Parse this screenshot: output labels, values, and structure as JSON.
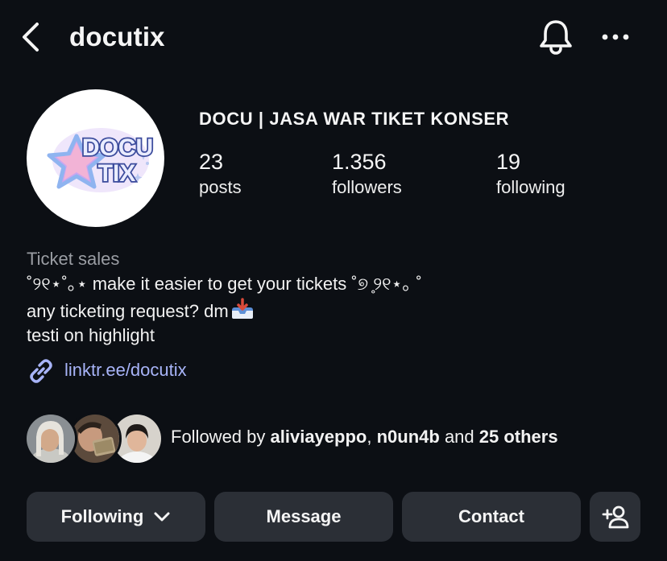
{
  "header": {
    "username": "docutix",
    "icons": {
      "back": "chevron-left-icon",
      "notifications": "bell-icon",
      "more": "more-horizontal-icon"
    }
  },
  "profile": {
    "avatar_text_line1": "DOCU",
    "avatar_text_line2": "TIX",
    "display_name": "DOCU | JASA WAR TIKET KONSER",
    "stats": [
      {
        "value": "23",
        "label": "posts"
      },
      {
        "value": "1.356",
        "label": "followers"
      },
      {
        "value": "19",
        "label": "following"
      }
    ]
  },
  "bio": {
    "category": "Ticket sales",
    "line1": "˚୨୧⋆˚｡⋆ make it easier to get your tickets ˚୭ ̥୨୧⋆｡ ˚",
    "line2": "any ticketing request? dm",
    "line3": "testi on highlight",
    "link": "linktr.ee/docutix"
  },
  "followed_by": {
    "prefix": "Followed by ",
    "user1": "aliviayeppo",
    "separator": ", ",
    "user2": "n0un4b",
    "middle": " and ",
    "others": "25 others"
  },
  "actions": {
    "following_label": "Following",
    "message_label": "Message",
    "contact_label": "Contact",
    "add_person_icon": "add-person-icon"
  },
  "colors": {
    "background": "#0c0f14",
    "button_bg": "#2b2f36",
    "link": "#a8b4f8",
    "category": "#9a9da3"
  }
}
